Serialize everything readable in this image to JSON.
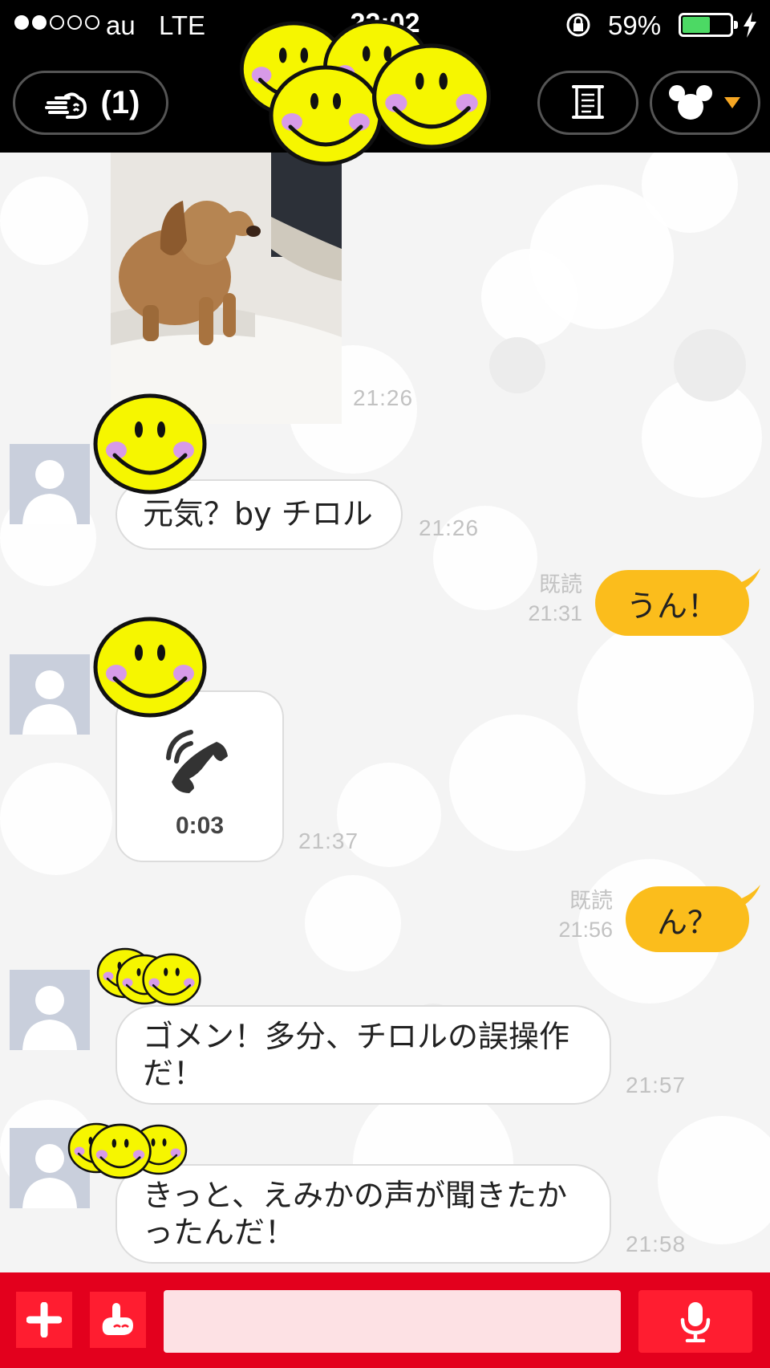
{
  "status_bar": {
    "carrier": "au",
    "network": "LTE",
    "time": "22:02",
    "battery_percent": "59%",
    "battery_level": 0.59,
    "signal_bars_filled": 2,
    "signal_bars_total": 5
  },
  "top_nav": {
    "notification_count": "(1)"
  },
  "colors": {
    "accent_red": "#e3001d",
    "outgoing_bubble": "#fbbd1c",
    "avatar_placeholder": "#c9cfdc"
  },
  "messages": [
    {
      "id": "m1",
      "direction": "in",
      "type": "photo",
      "time": "21:26"
    },
    {
      "id": "m2",
      "direction": "in",
      "type": "text",
      "text": "元気？by チロル",
      "time": "21:26"
    },
    {
      "id": "m3",
      "direction": "out",
      "type": "text",
      "text": "うん！",
      "read_label": "既読",
      "time": "21:31"
    },
    {
      "id": "m4",
      "direction": "in",
      "type": "call",
      "call_duration": "0:03",
      "time": "21:37"
    },
    {
      "id": "m5",
      "direction": "out",
      "type": "text",
      "text": "ん？",
      "read_label": "既読",
      "time": "21:56"
    },
    {
      "id": "m6",
      "direction": "in",
      "type": "text",
      "text_line1": "ゴメン！多分、チロルの誤操作",
      "text_line2": "だ！",
      "time": "21:57"
    },
    {
      "id": "m7",
      "direction": "in",
      "type": "text",
      "text_line1": "きっと、えみかの声が聞きたか",
      "text_line2": "ったんだ！",
      "time": "21:58"
    }
  ],
  "composer": {
    "input_value": "",
    "icons": [
      "plus-icon",
      "hand-icon",
      "microphone-icon"
    ]
  }
}
